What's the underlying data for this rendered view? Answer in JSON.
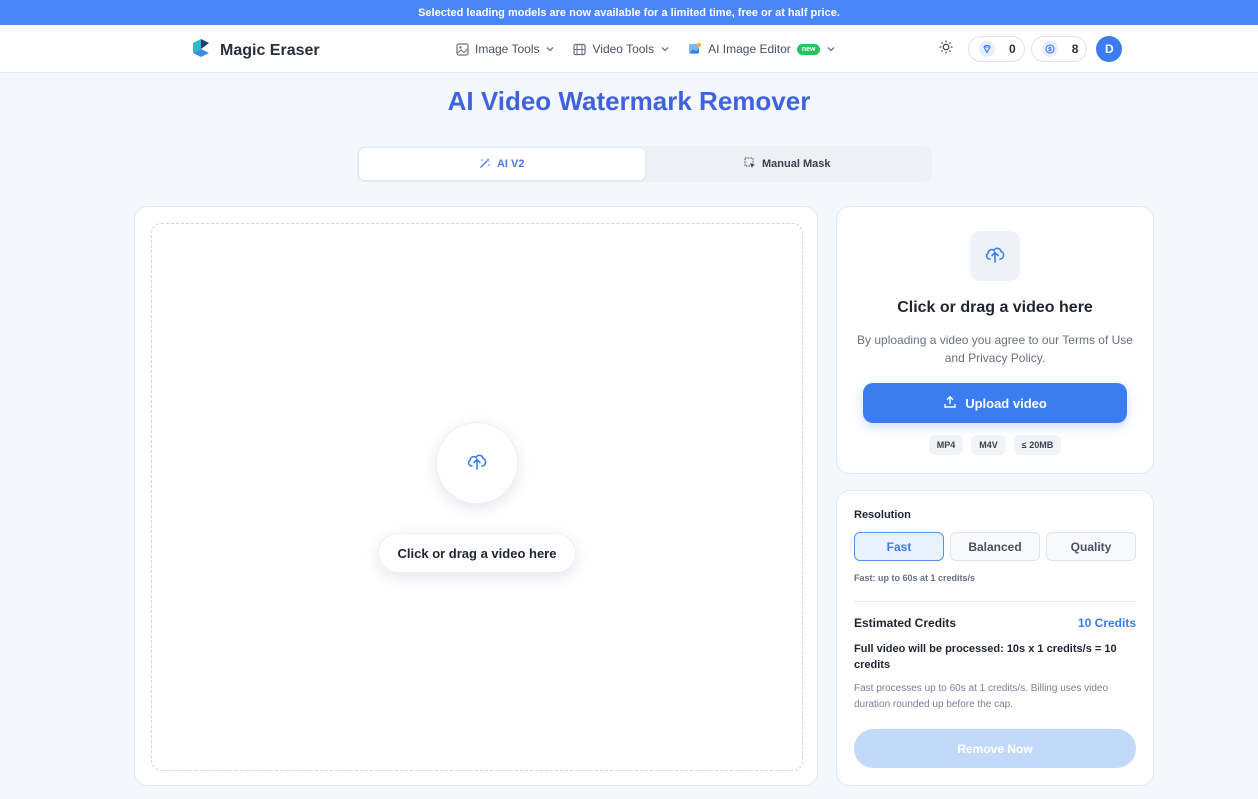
{
  "banner": {
    "text": "Selected leading models are now available for a limited time, free or at half price."
  },
  "header": {
    "brand": "Magic Eraser",
    "nav": [
      {
        "label": "Image Tools",
        "icon": "image-icon"
      },
      {
        "label": "Video Tools",
        "icon": "film-icon"
      },
      {
        "label": "AI Image Editor",
        "icon": "ai-editor-icon",
        "badge": "new"
      }
    ],
    "gems": "0",
    "coins": "8",
    "avatar": "D"
  },
  "page": {
    "title": "AI Video Watermark Remover",
    "tabs": [
      {
        "label": "AI V2",
        "icon": "magic-wand-icon",
        "active": true
      },
      {
        "label": "Manual Mask",
        "icon": "mask-select-icon",
        "active": false
      }
    ]
  },
  "dropzone": {
    "button_label": "Click or drag a video here"
  },
  "upload": {
    "title": "Click or drag a video here",
    "description": "By uploading a video you agree to our Terms of Use and Privacy Policy.",
    "button_label": "Upload video",
    "formats": [
      "MP4",
      "M4V",
      "≤ 20MB"
    ]
  },
  "settings": {
    "resolution_label": "Resolution",
    "options": [
      "Fast",
      "Balanced",
      "Quality"
    ],
    "selected": "Fast",
    "hint": "Fast: up to 60s at 1 credits/s",
    "estimated_label": "Estimated Credits",
    "estimated_value": "10 Credits",
    "formula": "Full video will be processed: 10s x 1 credits/s = 10 credits",
    "note": "Fast processes up to 60s at 1 credits/s. Billing uses video duration rounded up before the cap.",
    "remove_button": "Remove Now"
  },
  "colors": {
    "accent": "#3b7cf0",
    "title": "#3f63dd",
    "badge": "#22c55e",
    "banner": "#4a86f7"
  }
}
